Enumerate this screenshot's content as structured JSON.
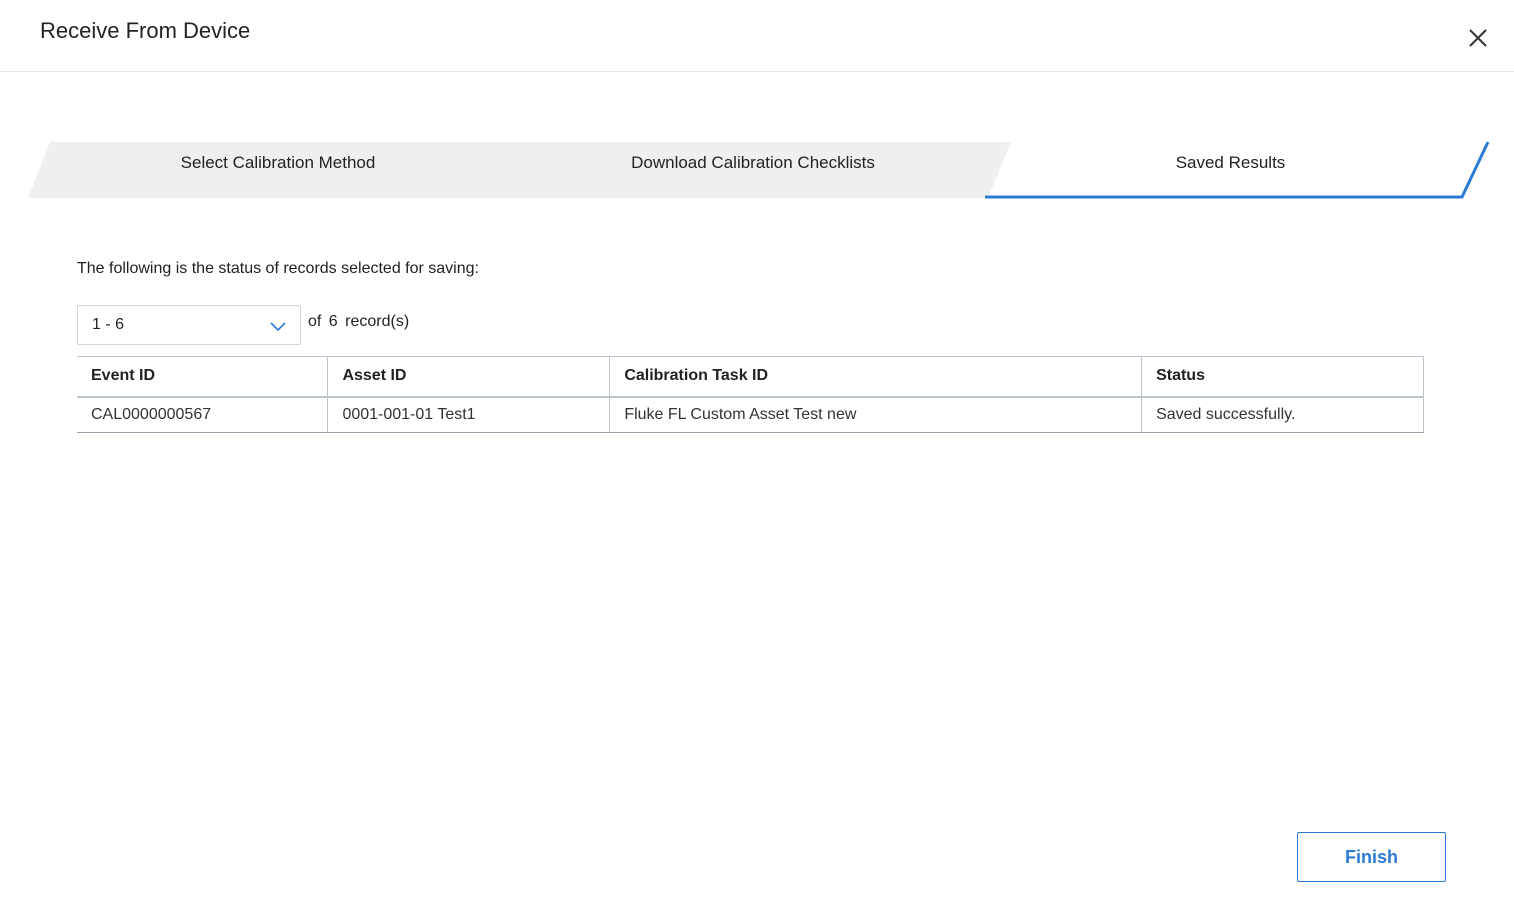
{
  "dialog": {
    "title": "Receive From Device"
  },
  "stepper": {
    "steps": [
      {
        "label": "Select Calibration Method",
        "state": "complete"
      },
      {
        "label": "Download Calibration Checklists",
        "state": "complete"
      },
      {
        "label": "Saved Results",
        "state": "active"
      }
    ],
    "active_color": "#2b7bd6",
    "inactive_bg": "#efefef"
  },
  "content": {
    "intro": "The following is the status of records selected for saving:",
    "pager": {
      "range": "1 - 6",
      "of_label": "of",
      "total": "6",
      "unit_label": "record(s)"
    },
    "table": {
      "columns": [
        "Event ID",
        "Asset ID",
        "Calibration Task ID",
        "Status"
      ],
      "rows": [
        [
          "CAL0000000567",
          "0001-001-01 Test1",
          "Fluke FL Custom Asset Test new",
          "Saved successfully."
        ]
      ]
    }
  },
  "footer": {
    "finish_label": "Finish"
  },
  "icons": {
    "close": "close-icon",
    "dropdown": "chevron-down-icon"
  }
}
